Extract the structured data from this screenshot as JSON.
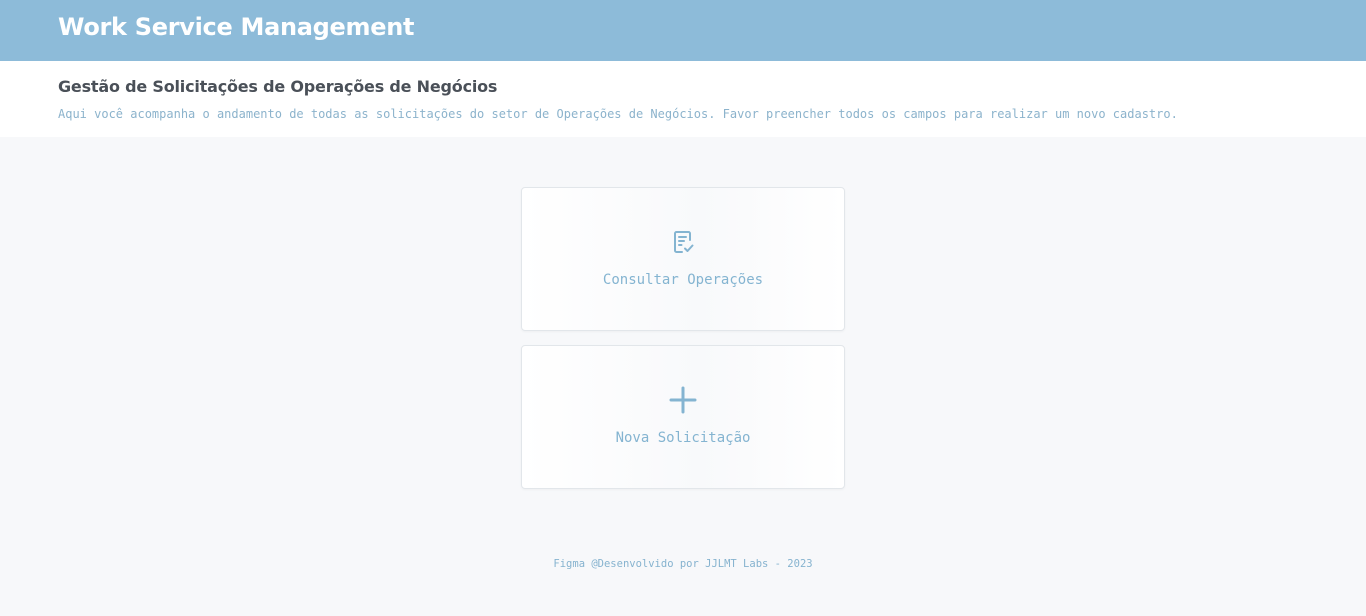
{
  "header": {
    "app_title": "Work Service Management"
  },
  "subheader": {
    "title": "Gestão de Solicitações de Operações de Negócios",
    "description": "Aqui você acompanha o andamento de todas as solicitações do setor de Operações de Negócios. Favor preencher todos os campos para realizar um novo cadastro."
  },
  "cards": [
    {
      "label": "Consultar Operações",
      "icon": "document-check-icon"
    },
    {
      "label": "Nova Solicitação",
      "icon": "plus-icon"
    }
  ],
  "footer": {
    "text": "Figma @Desenvolvido por JJLMT Labs - 2023"
  },
  "colors": {
    "header_bg": "#8dbbd9",
    "accent": "#84b4d1",
    "page_bg": "#f7f8fa",
    "title_text": "#4a5058"
  }
}
